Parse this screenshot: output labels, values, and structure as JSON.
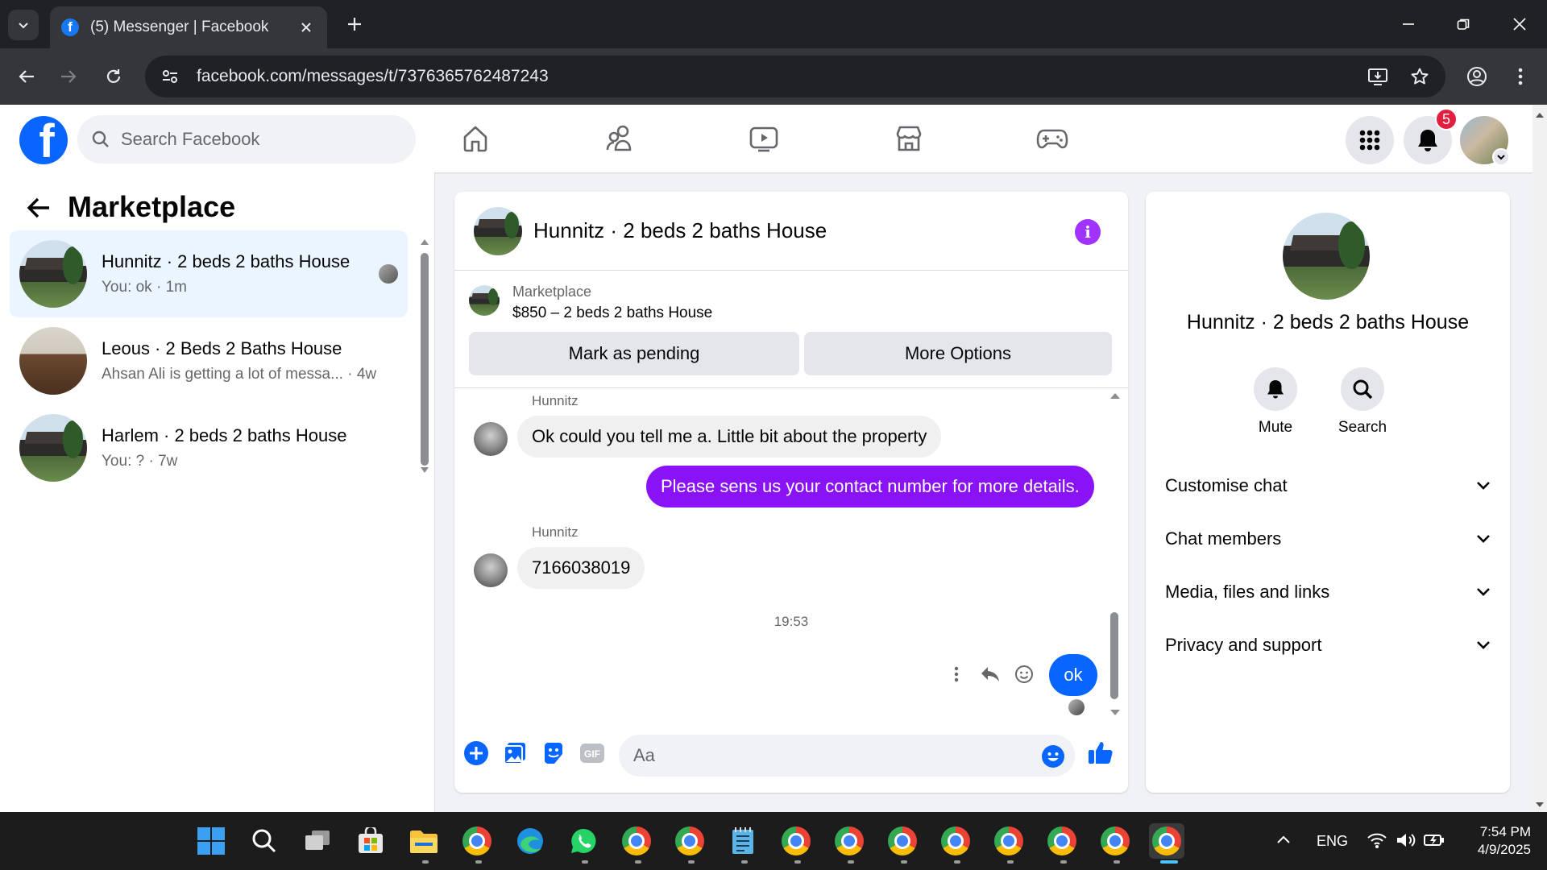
{
  "browser": {
    "tab_title": "(5) Messenger | Facebook",
    "url": "facebook.com/messages/t/7376365762487243"
  },
  "fb": {
    "search_placeholder": "Search Facebook",
    "notifications_count": "5",
    "brand_color": "#0866ff"
  },
  "left": {
    "title": "Marketplace",
    "conversations": [
      {
        "title": "Hunnitz · 2 beds 2 baths House",
        "subtitle": "You: ok · 1m",
        "active": true
      },
      {
        "title": "Leous · 2 Beds 2 Baths House",
        "subtitle": "Ahsan Ali is getting a lot of messa...  · 4w",
        "active": false
      },
      {
        "title": "Harlem · 2 beds 2 baths House",
        "subtitle": "You: ? · 7w",
        "active": false
      }
    ]
  },
  "chat": {
    "title": "Hunnitz · 2 beds 2 baths House",
    "listing_label": "Marketplace",
    "listing_price": "$850 – 2 beds 2 baths House",
    "btn_pending": "Mark as pending",
    "btn_more": "More Options",
    "messages": [
      {
        "sender": "Hunnitz",
        "text": "Ok could you tell me a. Little bit about the property",
        "direction": "in"
      },
      {
        "text": "Please sens us your contact number for more details.",
        "direction": "out"
      },
      {
        "sender": "Hunnitz",
        "text": "7166038019",
        "direction": "in"
      },
      {
        "timestamp": "19:53"
      },
      {
        "text": "ok",
        "direction": "out"
      }
    ],
    "composer_placeholder": "Aa",
    "purple": "#8a12f7"
  },
  "right": {
    "name": "Hunnitz · 2 beds 2 baths House",
    "actions": [
      "Mute",
      "Search"
    ],
    "sections": [
      "Customise chat",
      "Chat members",
      "Media, files and links",
      "Privacy and support"
    ]
  },
  "taskbar": {
    "lang": "ENG",
    "time": "7:54 PM",
    "date": "4/9/2025"
  }
}
